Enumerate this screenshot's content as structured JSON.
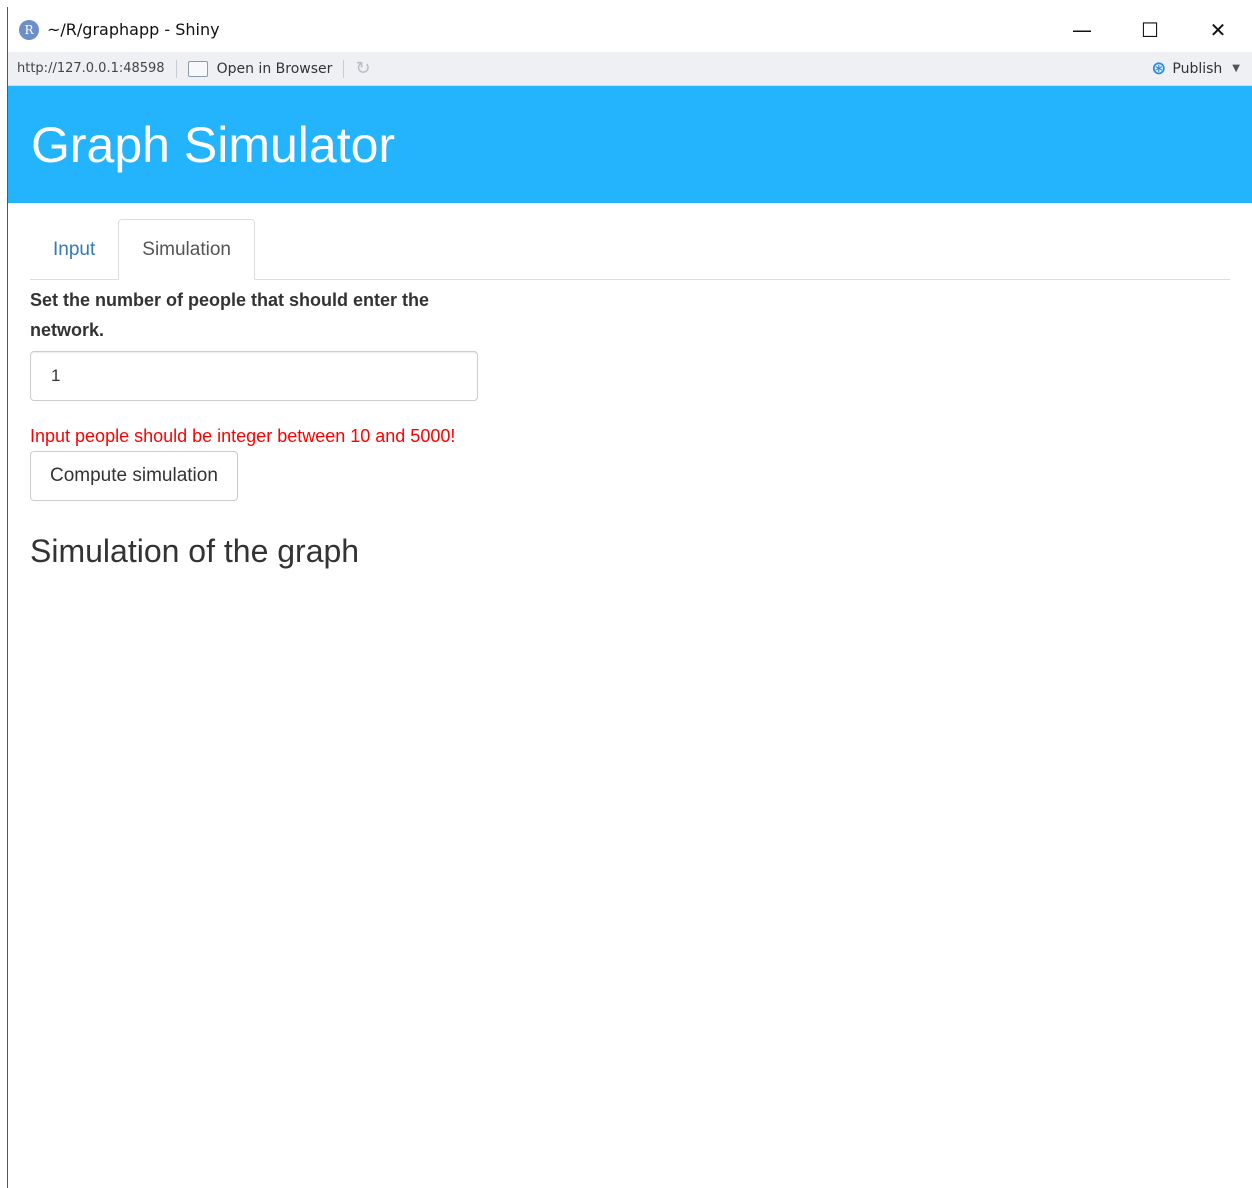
{
  "window": {
    "title": "~/R/graphapp - Shiny",
    "logo_letter": "R",
    "controls": {
      "minimize": "—",
      "maximize": "☐",
      "close": "✕"
    }
  },
  "toolbar": {
    "url": "http://127.0.0.1:48598",
    "open_in_browser": "Open in Browser",
    "publish": "Publish"
  },
  "header": {
    "title": "Graph Simulator"
  },
  "tabs": [
    {
      "label": "Input",
      "active": false
    },
    {
      "label": "Simulation",
      "active": true
    }
  ],
  "form": {
    "label": "Set the number of people that should enter the network.",
    "input_value": "1",
    "error": "Input people should be integer between 10 and 5000!",
    "button_label": "Compute simulation"
  },
  "section": {
    "title": "Simulation of the graph"
  },
  "colors": {
    "header_bg": "#24b4fe",
    "error": "#ff0000",
    "tab_link": "#337ab7",
    "publish_icon": "#2b8be6"
  }
}
